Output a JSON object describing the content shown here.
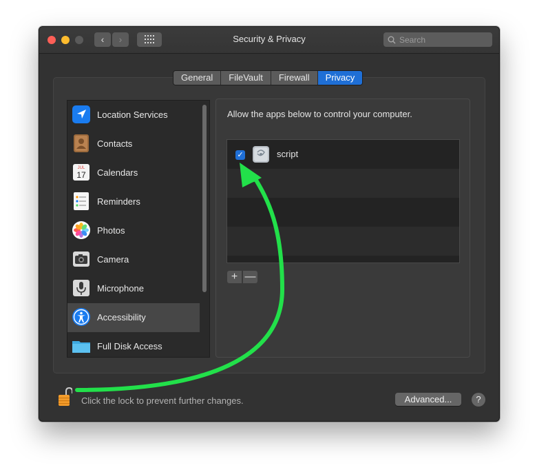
{
  "window": {
    "title": "Security & Privacy"
  },
  "toolbar": {
    "back_glyph": "‹",
    "forward_glyph": "›",
    "search_placeholder": "Search"
  },
  "tabs": [
    {
      "label": "General",
      "active": false
    },
    {
      "label": "FileVault",
      "active": false
    },
    {
      "label": "Firewall",
      "active": false
    },
    {
      "label": "Privacy",
      "active": true
    }
  ],
  "sidebar": {
    "items": [
      {
        "label": "Location Services",
        "icon": "location-icon"
      },
      {
        "label": "Contacts",
        "icon": "contacts-icon"
      },
      {
        "label": "Calendars",
        "icon": "calendar-icon",
        "icon_month": "JUL",
        "icon_day": "17"
      },
      {
        "label": "Reminders",
        "icon": "reminders-icon"
      },
      {
        "label": "Photos",
        "icon": "photos-icon"
      },
      {
        "label": "Camera",
        "icon": "camera-icon"
      },
      {
        "label": "Microphone",
        "icon": "microphone-icon"
      },
      {
        "label": "Accessibility",
        "icon": "accessibility-icon",
        "selected": true
      },
      {
        "label": "Full Disk Access",
        "icon": "folder-icon"
      }
    ]
  },
  "main": {
    "instruction": "Allow the apps below to control your computer.",
    "apps": [
      {
        "name": "script",
        "checked": true,
        "check_glyph": "✓"
      }
    ],
    "add_label": "+",
    "remove_label": "—"
  },
  "footer": {
    "lock_text": "Click the lock to prevent further changes.",
    "advanced_label": "Advanced...",
    "help_label": "?"
  },
  "colors": {
    "accent": "#1f6fd6",
    "annotation_arrow": "#22e04a",
    "close": "#fe5f57",
    "minimize": "#febc2e"
  }
}
